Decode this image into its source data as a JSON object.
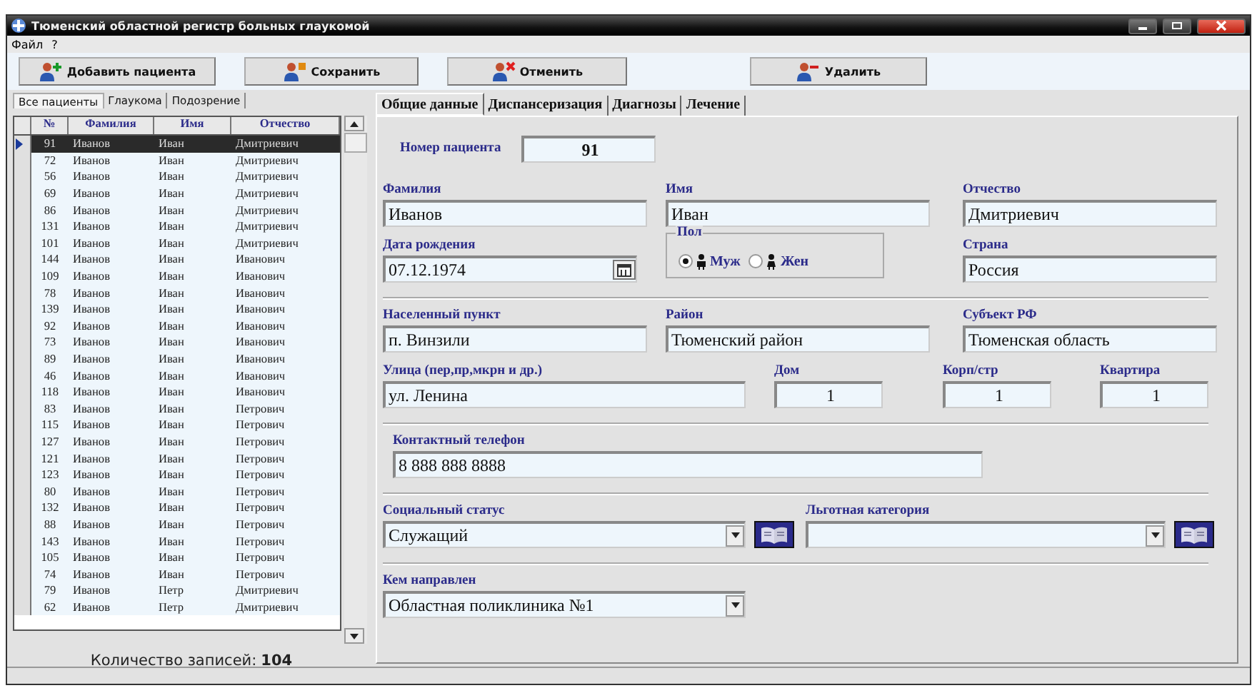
{
  "window": {
    "title": "Тюменский областной регистр больных глаукомой"
  },
  "menu": [
    {
      "label": "Файл"
    },
    {
      "label": "?"
    }
  ],
  "toolbar": [
    {
      "label": "Добавить пациента",
      "kind": "add"
    },
    {
      "label": "Сохранить",
      "kind": "save"
    },
    {
      "label": "Отменить",
      "kind": "cancel"
    },
    {
      "label": "Удалить",
      "kind": "delete"
    }
  ],
  "list_tabs": [
    {
      "label": "Все пациенты",
      "selected": true
    },
    {
      "label": "Глаукома",
      "selected": false
    },
    {
      "label": "Подозрение",
      "selected": false
    }
  ],
  "table": {
    "columns": [
      "№",
      "Фамилия",
      "Имя",
      "Отчество"
    ],
    "rows": [
      {
        "cells": [
          "91",
          "Иванов",
          "Иван",
          "Дмитриевич"
        ],
        "selected": true
      },
      {
        "cells": [
          "72",
          "Иванов",
          "Иван",
          "Дмитриевич"
        ],
        "selected": false
      },
      {
        "cells": [
          "56",
          "Иванов",
          "Иван",
          "Дмитриевич"
        ],
        "selected": false
      },
      {
        "cells": [
          "69",
          "Иванов",
          "Иван",
          "Дмитриевич"
        ],
        "selected": false
      },
      {
        "cells": [
          "86",
          "Иванов",
          "Иван",
          "Дмитриевич"
        ],
        "selected": false
      },
      {
        "cells": [
          "131",
          "Иванов",
          "Иван",
          "Дмитриевич"
        ],
        "selected": false
      },
      {
        "cells": [
          "101",
          "Иванов",
          "Иван",
          "Дмитриевич"
        ],
        "selected": false
      },
      {
        "cells": [
          "144",
          "Иванов",
          "Иван",
          "Иванович"
        ],
        "selected": false
      },
      {
        "cells": [
          "109",
          "Иванов",
          "Иван",
          "Иванович"
        ],
        "selected": false
      },
      {
        "cells": [
          "78",
          "Иванов",
          "Иван",
          "Иванович"
        ],
        "selected": false
      },
      {
        "cells": [
          "139",
          "Иванов",
          "Иван",
          "Иванович"
        ],
        "selected": false
      },
      {
        "cells": [
          "92",
          "Иванов",
          "Иван",
          "Иванович"
        ],
        "selected": false
      },
      {
        "cells": [
          "73",
          "Иванов",
          "Иван",
          "Иванович"
        ],
        "selected": false
      },
      {
        "cells": [
          "89",
          "Иванов",
          "Иван",
          "Иванович"
        ],
        "selected": false
      },
      {
        "cells": [
          "46",
          "Иванов",
          "Иван",
          "Иванович"
        ],
        "selected": false
      },
      {
        "cells": [
          "118",
          "Иванов",
          "Иван",
          "Иванович"
        ],
        "selected": false
      },
      {
        "cells": [
          "83",
          "Иванов",
          "Иван",
          "Петрович"
        ],
        "selected": false
      },
      {
        "cells": [
          "115",
          "Иванов",
          "Иван",
          "Петрович"
        ],
        "selected": false
      },
      {
        "cells": [
          "127",
          "Иванов",
          "Иван",
          "Петрович"
        ],
        "selected": false
      },
      {
        "cells": [
          "121",
          "Иванов",
          "Иван",
          "Петрович"
        ],
        "selected": false
      },
      {
        "cells": [
          "123",
          "Иванов",
          "Иван",
          "Петрович"
        ],
        "selected": false
      },
      {
        "cells": [
          "80",
          "Иванов",
          "Иван",
          "Петрович"
        ],
        "selected": false
      },
      {
        "cells": [
          "132",
          "Иванов",
          "Иван",
          "Петрович"
        ],
        "selected": false
      },
      {
        "cells": [
          "88",
          "Иванов",
          "Иван",
          "Петрович"
        ],
        "selected": false
      },
      {
        "cells": [
          "143",
          "Иванов",
          "Иван",
          "Петрович"
        ],
        "selected": false
      },
      {
        "cells": [
          "105",
          "Иванов",
          "Иван",
          "Петрович"
        ],
        "selected": false
      },
      {
        "cells": [
          "74",
          "Иванов",
          "Иван",
          "Петрович"
        ],
        "selected": false
      },
      {
        "cells": [
          "79",
          "Иванов",
          "Петр",
          "Дмитриевич"
        ],
        "selected": false
      },
      {
        "cells": [
          "62",
          "Иванов",
          "Петр",
          "Дмитриевич"
        ],
        "selected": false
      }
    ]
  },
  "record_count": {
    "label": "Количество записей:",
    "value": "104"
  },
  "form_tabs": [
    {
      "label": "Общие данные",
      "selected": true
    },
    {
      "label": "Диспансеризация",
      "selected": false
    },
    {
      "label": "Диагнозы",
      "selected": false
    },
    {
      "label": "Лечение",
      "selected": false
    }
  ],
  "patient_number": {
    "label": "Номер пациента",
    "value": "91"
  },
  "sections": [
    {
      "rows": [
        [
          {
            "label": "Фамилия",
            "value": "Иванов",
            "kind": "text"
          },
          {
            "label": "Имя",
            "value": "Иван",
            "kind": "text"
          },
          {
            "label": "Отчество",
            "value": "Дмитриевич",
            "kind": "text"
          }
        ],
        [
          {
            "label": "Дата рождения",
            "value": "07.12.1974",
            "kind": "date"
          },
          {
            "label": "Пол",
            "kind": "gender",
            "options": [
              {
                "label": "Муж",
                "selected": true
              },
              {
                "label": "Жен",
                "selected": false
              }
            ]
          },
          {
            "label": "Страна",
            "value": "Россия",
            "kind": "text"
          }
        ]
      ]
    },
    {
      "rows": [
        [
          {
            "label": "Населенный пункт",
            "value": "п. Винзили",
            "kind": "text"
          },
          {
            "label": "Район",
            "value": "Тюменский район",
            "kind": "text"
          },
          {
            "label": "Субъект РФ",
            "value": "Тюменская область",
            "kind": "text"
          }
        ],
        [
          {
            "label": "Улица (пер,пр,мкрн и др.)",
            "value": "ул. Ленина",
            "kind": "text"
          },
          {
            "label": "Дом",
            "value": "1",
            "kind": "number"
          },
          {
            "label": "Корп/стр",
            "value": "1",
            "kind": "number"
          },
          {
            "label": "Квартира",
            "value": "1",
            "kind": "number"
          }
        ]
      ]
    },
    {
      "rows": [
        [
          {
            "label": "Контактный телефон",
            "value": "8 888 888 8888",
            "kind": "text"
          }
        ]
      ]
    },
    {
      "rows": [
        [
          {
            "label": "Социальный статус",
            "value": "Служащий",
            "kind": "combo",
            "has_book": true
          },
          {
            "label": "Льготная категория",
            "kind": "combo",
            "has_book": true
          }
        ]
      ]
    },
    {
      "rows": [
        [
          {
            "label": "Кем направлен",
            "value": "Областная поликлиника №1",
            "kind": "combo",
            "has_book": false
          }
        ]
      ]
    }
  ]
}
